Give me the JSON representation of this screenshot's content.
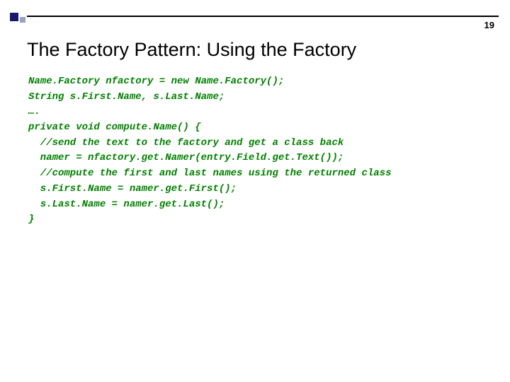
{
  "slide_number": "19",
  "title": "The Factory Pattern: Using the Factory",
  "code": {
    "l1": "Name.Factory nfactory = new Name.Factory();",
    "l2": "String s.First.Name, s.Last.Name;",
    "l3": "….",
    "l4": "private void compute.Name() {",
    "l5": "  //send the text to the factory and get a class back",
    "l6": "  namer = nfactory.get.Namer(entry.Field.get.Text());",
    "l7": "  //compute the first and last names using the returned class",
    "l8": "  s.First.Name = namer.get.First();",
    "l9": "  s.Last.Name = namer.get.Last();",
    "l10": "}"
  }
}
